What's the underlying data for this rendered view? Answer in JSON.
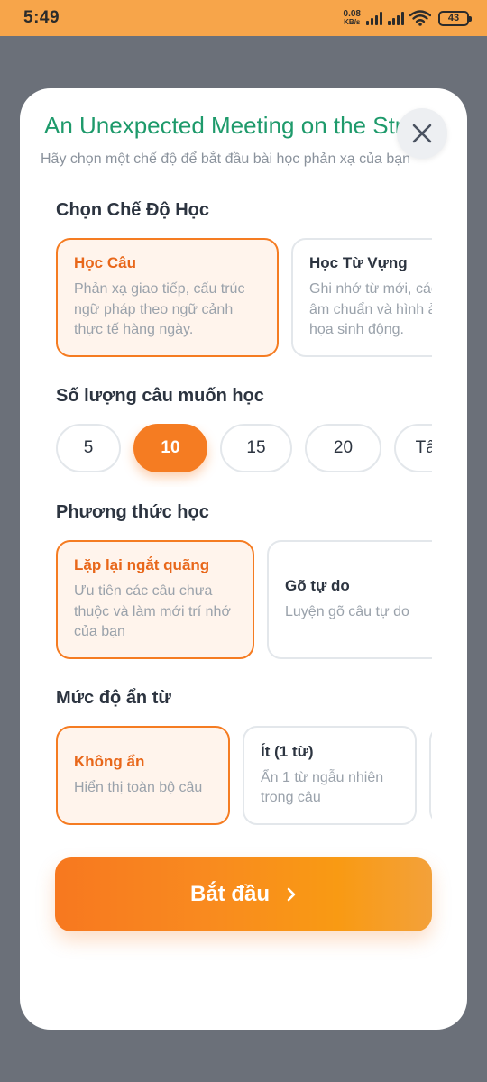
{
  "status_bar": {
    "time": "5:49",
    "net_speed_value": "0.08",
    "net_speed_unit": "KB/s",
    "battery": "43",
    "icons": [
      "signal-icon",
      "signal-icon",
      "wifi-icon",
      "battery-icon"
    ]
  },
  "modal": {
    "title": "An Unexpected Meeting on the Street",
    "subtitle": "Hãy chọn một chế độ để bắt đầu bài học phản xạ của bạn",
    "close_icon": "close-icon"
  },
  "mode_section": {
    "label": "Chọn Chế Độ Học",
    "options": [
      {
        "title": "Học Câu",
        "desc": "Phản xạ giao tiếp, cấu trúc ngữ pháp theo ngữ cảnh thực tế hàng ngày.",
        "selected": true
      },
      {
        "title": "Học Từ Vựng",
        "desc": "Ghi nhớ từ mới, cách phát âm chuẩn và hình ảnh minh họa sinh động.",
        "selected": false
      }
    ]
  },
  "count_section": {
    "label": "Số lượng câu muốn học",
    "options": [
      "5",
      "10",
      "15",
      "20",
      "Tất cả"
    ],
    "selected": "10"
  },
  "method_section": {
    "label": "Phương thức học",
    "options": [
      {
        "title": "Lặp lại ngắt quãng",
        "desc": "Ưu tiên các câu chưa thuộc và làm mới trí nhớ của bạn",
        "selected": true
      },
      {
        "title": "Gõ tự do",
        "desc": "Luyện gõ câu tự do",
        "selected": false
      }
    ]
  },
  "hide_section": {
    "label": "Mức độ ẩn từ",
    "options": [
      {
        "title": "Không ẩn",
        "desc": "Hiển thị toàn bộ câu",
        "selected": true
      },
      {
        "title": "Ít (1 từ)",
        "desc": "Ẩn 1 từ ngẫu nhiên trong câu",
        "selected": false
      },
      {
        "title": "",
        "desc": "",
        "selected": false
      }
    ]
  },
  "start_button": {
    "label": "Bắt đầu",
    "icon": "chevron-right-icon"
  },
  "colors": {
    "accent": "#f57c22",
    "title_green": "#1e9a6b",
    "status_bar": "#f7a54a",
    "overlay": "#6b7079"
  }
}
